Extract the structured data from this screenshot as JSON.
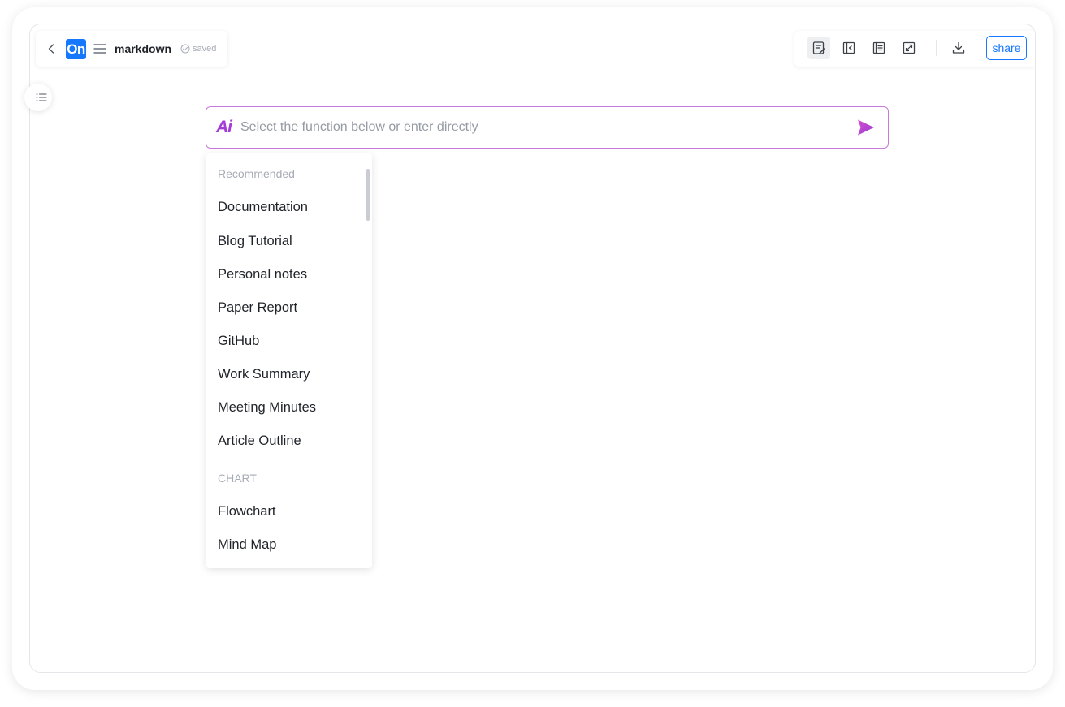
{
  "header": {
    "logo_text": "On",
    "doc_title": "markdown",
    "save_status": "saved"
  },
  "toolbar": {
    "share_label": "share",
    "icons": [
      "edit-mode-icon",
      "split-preview-icon",
      "reading-mode-icon",
      "fullscreen-icon",
      "download-icon"
    ]
  },
  "ai_input": {
    "logo_text": "Ai",
    "placeholder": "Select the function below or enter directly"
  },
  "dropdown": {
    "sections": [
      {
        "header": "Recommended",
        "items": [
          "Documentation",
          "Blog Tutorial",
          "Personal notes",
          "Paper Report",
          "GitHub",
          "Work Summary",
          "Meeting Minutes",
          "Article Outline"
        ]
      },
      {
        "header": "CHART",
        "items": [
          "Flowchart",
          "Mind Map"
        ]
      }
    ]
  },
  "colors": {
    "accent_blue": "#1677ff",
    "ai_purple": "#a43bd6",
    "ai_border": "#c979d9"
  }
}
